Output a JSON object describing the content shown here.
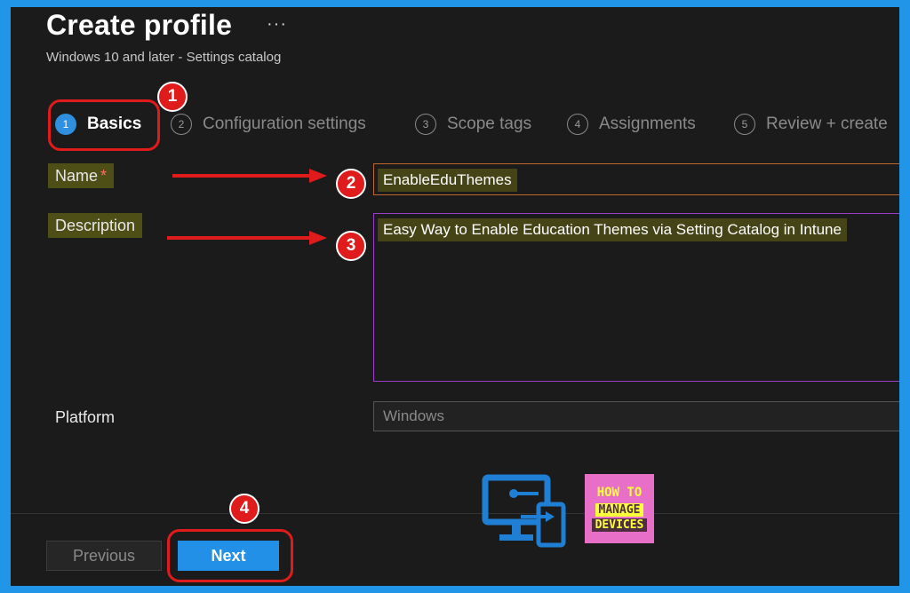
{
  "header": {
    "title": "Create profile",
    "more": "···",
    "subtitle": "Windows 10 and later - Settings catalog"
  },
  "steps": [
    {
      "num": "1",
      "label": "Basics",
      "active": true
    },
    {
      "num": "2",
      "label": "Configuration settings"
    },
    {
      "num": "3",
      "label": "Scope tags"
    },
    {
      "num": "4",
      "label": "Assignments"
    },
    {
      "num": "5",
      "label": "Review + create"
    }
  ],
  "form": {
    "name_label": "Name",
    "required_mark": "*",
    "name_value": "EnableEduThemes",
    "description_label": "Description",
    "description_value": "Easy Way to Enable Education Themes via Setting Catalog in Intune",
    "platform_label": "Platform",
    "platform_value": "Windows"
  },
  "buttons": {
    "previous": "Previous",
    "next": "Next"
  },
  "annotations": {
    "badges": [
      "1",
      "2",
      "3",
      "4"
    ],
    "color": "#e01b1b"
  },
  "logo": {
    "line1": "HOW TO",
    "line2": "MANAGE",
    "line3": "DEVICES",
    "monitor_icon": "monitor-icon"
  },
  "colors": {
    "frame": "#2196e8",
    "accent": "#2290e6",
    "field_border": "#9a3ec7"
  }
}
